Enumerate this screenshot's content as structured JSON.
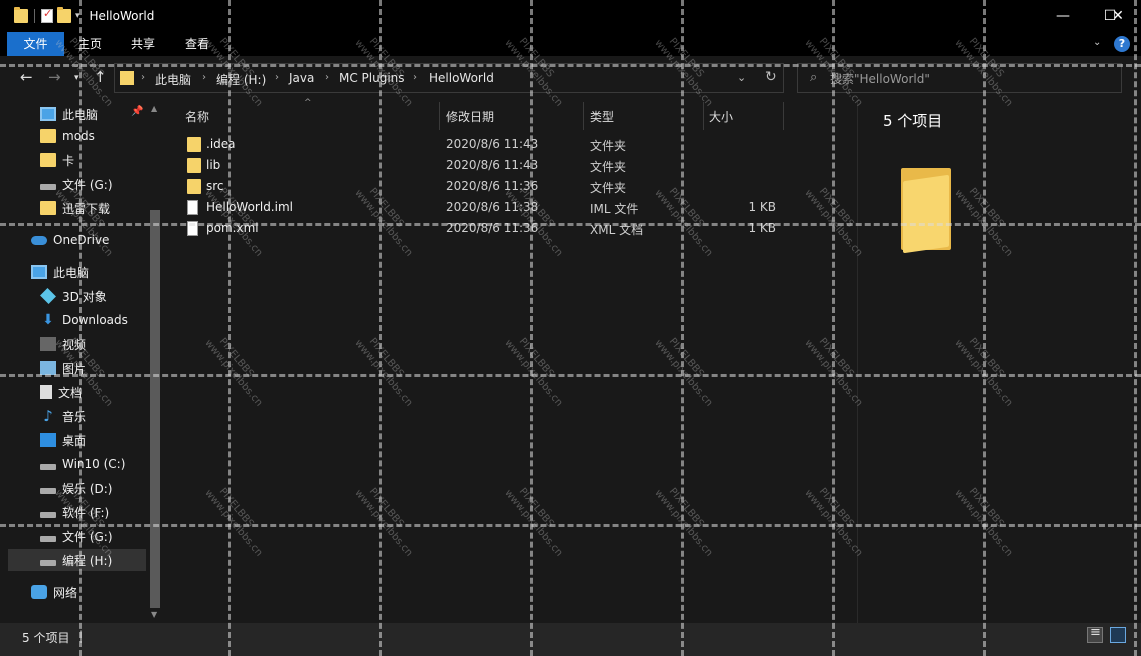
{
  "window": {
    "title": "HelloWorld",
    "controls": {
      "minimize": "—",
      "maximize": "☐",
      "close": "✕"
    }
  },
  "ribbon": {
    "tabs": [
      {
        "label": "文件",
        "active": true
      },
      {
        "label": "主页"
      },
      {
        "label": "共享"
      },
      {
        "label": "查看"
      }
    ],
    "help_label": "?",
    "accent_color": "#1a6fcc"
  },
  "address_bar": {
    "breadcrumbs": [
      "此电脑",
      "编程 (H:)",
      "Java",
      "MC Plugins",
      "HelloWorld"
    ],
    "search_placeholder": "搜索\"HelloWorld\""
  },
  "nav_pane": {
    "items": [
      {
        "label": "此电脑",
        "icon": "pc-icon",
        "pinned": true
      },
      {
        "label": "mods",
        "icon": "folder-icon"
      },
      {
        "label": "卡",
        "icon": "folder-icon"
      },
      {
        "label": "文件 (G:)",
        "icon": "drive-icon"
      },
      {
        "label": "迅雷下载",
        "icon": "folder-icon"
      },
      {
        "label": "OneDrive",
        "icon": "onedrive-icon"
      },
      {
        "label": "此电脑",
        "icon": "pc-icon"
      },
      {
        "label": "3D 对象",
        "icon": "3d-objects-icon"
      },
      {
        "label": "Downloads",
        "icon": "download-icon"
      },
      {
        "label": "视频",
        "icon": "video-icon"
      },
      {
        "label": "图片",
        "icon": "picture-icon"
      },
      {
        "label": "文档",
        "icon": "document-icon"
      },
      {
        "label": "音乐",
        "icon": "music-icon"
      },
      {
        "label": "桌面",
        "icon": "desktop-icon"
      },
      {
        "label": "Win10 (C:)",
        "icon": "drive-icon"
      },
      {
        "label": "娱乐 (D:)",
        "icon": "drive-icon"
      },
      {
        "label": "软件 (F:)",
        "icon": "drive-icon"
      },
      {
        "label": "文件 (G:)",
        "icon": "drive-icon"
      },
      {
        "label": "编程 (H:)",
        "icon": "drive-icon",
        "selected": true
      },
      {
        "label": "网络",
        "icon": "network-icon"
      }
    ]
  },
  "file_list": {
    "columns": [
      "名称",
      "修改日期",
      "类型",
      "大小"
    ],
    "rows": [
      {
        "name": ".idea",
        "date": "2020/8/6 11:43",
        "type": "文件夹",
        "size": "",
        "icon": "folder-icon"
      },
      {
        "name": "lib",
        "date": "2020/8/6 11:43",
        "type": "文件夹",
        "size": "",
        "icon": "folder-icon"
      },
      {
        "name": "src",
        "date": "2020/8/6 11:36",
        "type": "文件夹",
        "size": "",
        "icon": "folder-icon"
      },
      {
        "name": "HelloWorld.iml",
        "date": "2020/8/6 11:38",
        "type": "IML 文件",
        "size": "1 KB",
        "icon": "file-icon"
      },
      {
        "name": "pom.xml",
        "date": "2020/8/6 11:36",
        "type": "XML 文档",
        "size": "1 KB",
        "icon": "file-icon"
      }
    ]
  },
  "details_pane": {
    "item_count": "5 个项目"
  },
  "status_bar": {
    "item_count": "5 个项目",
    "cursor": "|"
  },
  "watermark": {
    "brand": "PIXELBBS",
    "site": "www.pixelbbs.cn"
  }
}
